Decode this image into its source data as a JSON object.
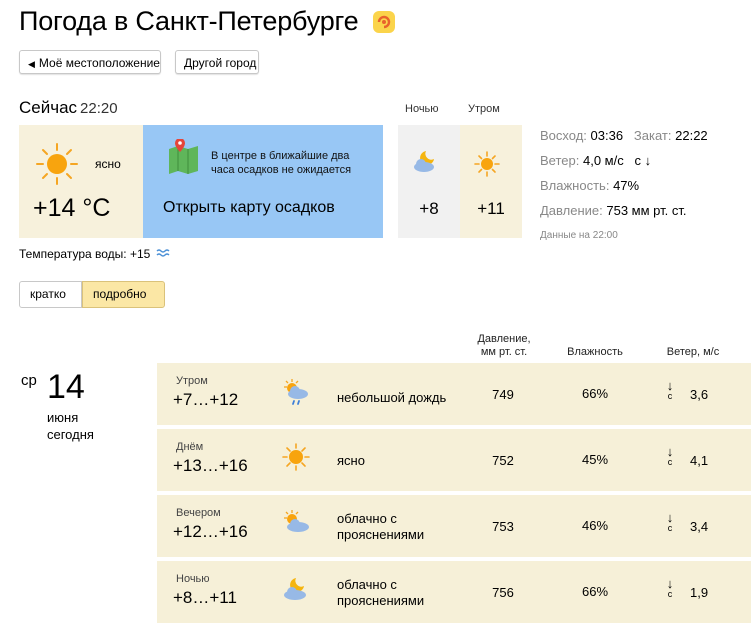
{
  "header": {
    "title": "Погода в Санкт-Петербурге"
  },
  "buttons": {
    "my_location": "Моё местоположение",
    "other_city": "Другой город"
  },
  "now": {
    "label": "Сейчас",
    "time": "22:20",
    "condition": "ясно",
    "temperature": "+14 °C",
    "map_text": "В центре в ближайшие два часа осадков не ожидается",
    "map_link": "Открыть карту осадков",
    "water_temp": "Температура воды: +15"
  },
  "next": {
    "night_label": "Ночью",
    "night_temp": "+8",
    "morning_label": "Утром",
    "morning_temp": "+11"
  },
  "details": {
    "sunrise_label": "Восход:",
    "sunrise": "03:36",
    "sunset_label": "Закат:",
    "sunset": "22:22",
    "wind_label": "Ветер:",
    "wind": "4,0 м/с   с ↓",
    "humidity_label": "Влажность:",
    "humidity": "47%",
    "pressure_label": "Давление:",
    "pressure": "753 мм рт. ст.",
    "data_time": "Данные на 22:00"
  },
  "toggle": {
    "short": "кратко",
    "detailed": "подробно",
    "active": "detailed"
  },
  "columns": {
    "pressure_l1": "Давление,",
    "pressure_l2": "мм рт. ст.",
    "humidity": "Влажность",
    "wind": "Ветер, м/с"
  },
  "day": {
    "dow": "ср",
    "num": "14",
    "month": "июня",
    "rel": "сегодня"
  },
  "forecast": [
    {
      "period": "Утром",
      "range": "+7…+12",
      "icon": "cloud-sun-rain-icon",
      "cond_l1": "небольшой дождь",
      "cond_l2": "",
      "pressure": "749",
      "humidity": "66%",
      "wind_dir": "с",
      "wind": "3,6"
    },
    {
      "period": "Днём",
      "range": "+13…+16",
      "icon": "sun-icon",
      "cond_l1": "ясно",
      "cond_l2": "",
      "pressure": "752",
      "humidity": "45%",
      "wind_dir": "с",
      "wind": "4,1"
    },
    {
      "period": "Вечером",
      "range": "+12…+16",
      "icon": "cloud-sun-icon",
      "cond_l1": "облачно с",
      "cond_l2": "прояснениями",
      "pressure": "753",
      "humidity": "46%",
      "wind_dir": "с",
      "wind": "3,4"
    },
    {
      "period": "Ночью",
      "range": "+8…+11",
      "icon": "cloud-moon-icon",
      "cond_l1": "облачно с",
      "cond_l2": "прояснениями",
      "pressure": "756",
      "humidity": "66%",
      "wind_dir": "с",
      "wind": "1,9"
    }
  ],
  "colors": {
    "sun": "#f5a623",
    "sky_card": "#98c7f5",
    "warm_card": "#f7f1dc",
    "row_bg": "#f6f0d8",
    "toggle_active": "#fbe7a5"
  }
}
